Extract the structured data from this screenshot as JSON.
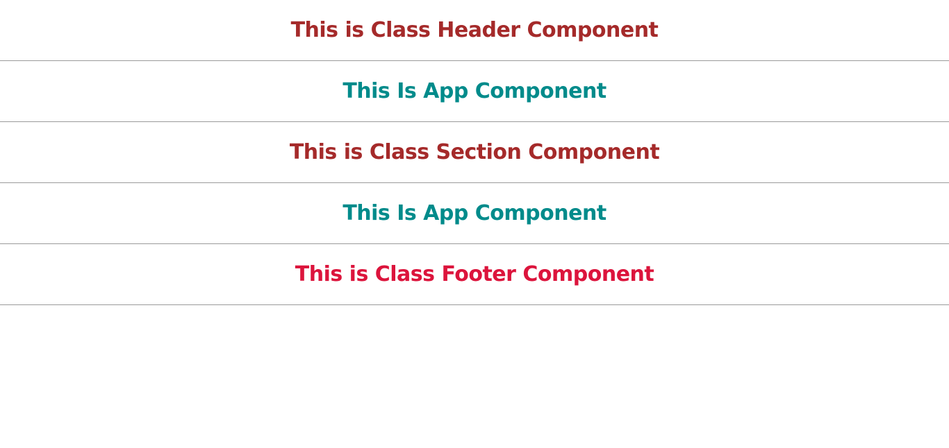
{
  "components": {
    "header": {
      "text": "This is Class Header Component",
      "color": "#a52a2a"
    },
    "app_first": {
      "text": "This Is App Component",
      "color": "#008b8b"
    },
    "section": {
      "text": "This is Class Section Component",
      "color": "#a52a2a"
    },
    "app_second": {
      "text": "This Is App Component",
      "color": "#008b8b"
    },
    "footer": {
      "text": "This is Class Footer Component",
      "color": "#dc143c"
    }
  }
}
